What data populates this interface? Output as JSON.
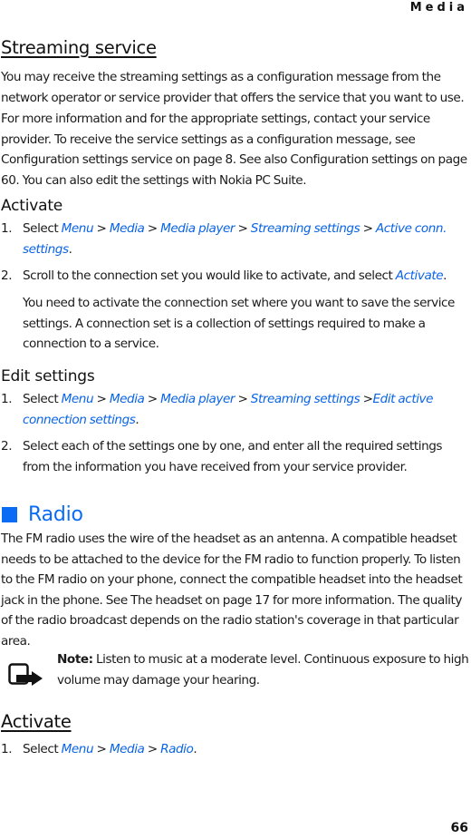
{
  "header": {
    "running_head": "Media"
  },
  "footer": {
    "page_number": "66"
  },
  "streaming": {
    "title": "Streaming service",
    "para1": "You may receive the streaming settings as a configuration message from the network operator or service provider that offers the service that you want to use.",
    "para2": "For more information and for the appropriate settings, contact your service provider. To receive the service settings as a configuration message, see Configuration settings service on page 8. See also Configuration settings on page 60. You can also edit the settings with Nokia PC Suite.",
    "activate": {
      "title": "Activate",
      "step1": {
        "num": "1.",
        "prefix": "Select ",
        "path": [
          "Menu",
          "Media",
          "Media player",
          "Streaming settings",
          "Active conn. settings"
        ],
        "sep": " > ",
        "end": "."
      },
      "step2": {
        "num": "2.",
        "prefix": "Scroll to the connection set you would like to activate, and select ",
        "link": "Activate",
        "end": ".",
        "note": "You need to activate the connection set where you want to save the service settings. A connection set is a collection of settings required to make a connection to a service."
      }
    },
    "edit": {
      "title": "Edit settings",
      "step1": {
        "num": "1.",
        "prefix": "Select ",
        "path": [
          "Menu",
          "Media",
          "Media player",
          "Streaming settings",
          "Edit active connection settings"
        ],
        "end": "."
      },
      "step2": {
        "num": "2.",
        "text": "Select each of the settings one by one, and enter all the required settings from the information you have received from your service provider."
      }
    }
  },
  "radio": {
    "title": "Radio",
    "para": "The FM radio uses the wire of the headset as an antenna. A compatible headset needs to be attached to the device for the FM radio to function properly. To listen to the FM radio on your phone, connect the compatible headset into the headset jack in the phone. See The headset on page 17 for more information. The quality of the radio broadcast depends on the radio station's coverage in that particular area.",
    "note": {
      "label": "Note:",
      "text": " Listen to music at a moderate level. Continuous exposure to high volume may damage your hearing.",
      "icon": "note-icon"
    },
    "activate": {
      "title": "Activate",
      "step1": {
        "num": "1.",
        "prefix": "Select ",
        "path": [
          "Menu",
          "Media",
          "Radio"
        ],
        "end": "."
      }
    }
  },
  "colors": {
    "link": "#0a64e6",
    "accent": "#0a6cf5"
  }
}
